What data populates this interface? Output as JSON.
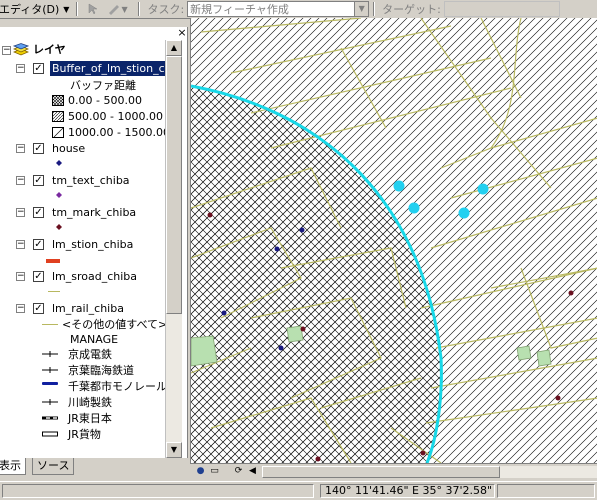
{
  "toolbar": {
    "editor_label": "エディタ(D)",
    "task_label": "タスク:",
    "task_value": "新規フィーチャ作成",
    "target_label": "ターゲット:"
  },
  "toc": {
    "root_label": "レイヤ",
    "layers": [
      {
        "label": "Buffer_of_lm_stion_chi",
        "checked": true,
        "selected": true,
        "legend_title": "バッファ距離",
        "legend": [
          "0.00 - 500.00",
          "500.00 - 1000.00",
          "1000.00 - 1500.00"
        ]
      },
      {
        "label": "house",
        "checked": true
      },
      {
        "label": "tm_text_chiba",
        "checked": true
      },
      {
        "label": "tm_mark_chiba",
        "checked": true
      },
      {
        "label": "lm_stion_chiba",
        "checked": true
      },
      {
        "label": "lm_sroad_chiba",
        "checked": true
      },
      {
        "label": "lm_rail_chiba",
        "checked": true,
        "legend": [
          "<その他の値すべて>",
          "MANAGE",
          "京成電鉄",
          "京葉臨海鉄道",
          "千葉都市モノレール",
          "川崎製鉄",
          "JR東日本",
          "JR貨物"
        ]
      }
    ]
  },
  "tabs": {
    "display": "表示",
    "source": "ソース"
  },
  "status": {
    "coords": "140°  11'41.46\" E  35°  37'2.58\""
  },
  "colors": {
    "buffer_circle": "#18d8e8",
    "station_dot": "#22d0f0",
    "road": "#b8b860",
    "house": "#1a1a80",
    "mark": "#6a1020",
    "text_point": "#7a2aa0",
    "station_legend": "#e04020",
    "selection": "#0a246a"
  }
}
